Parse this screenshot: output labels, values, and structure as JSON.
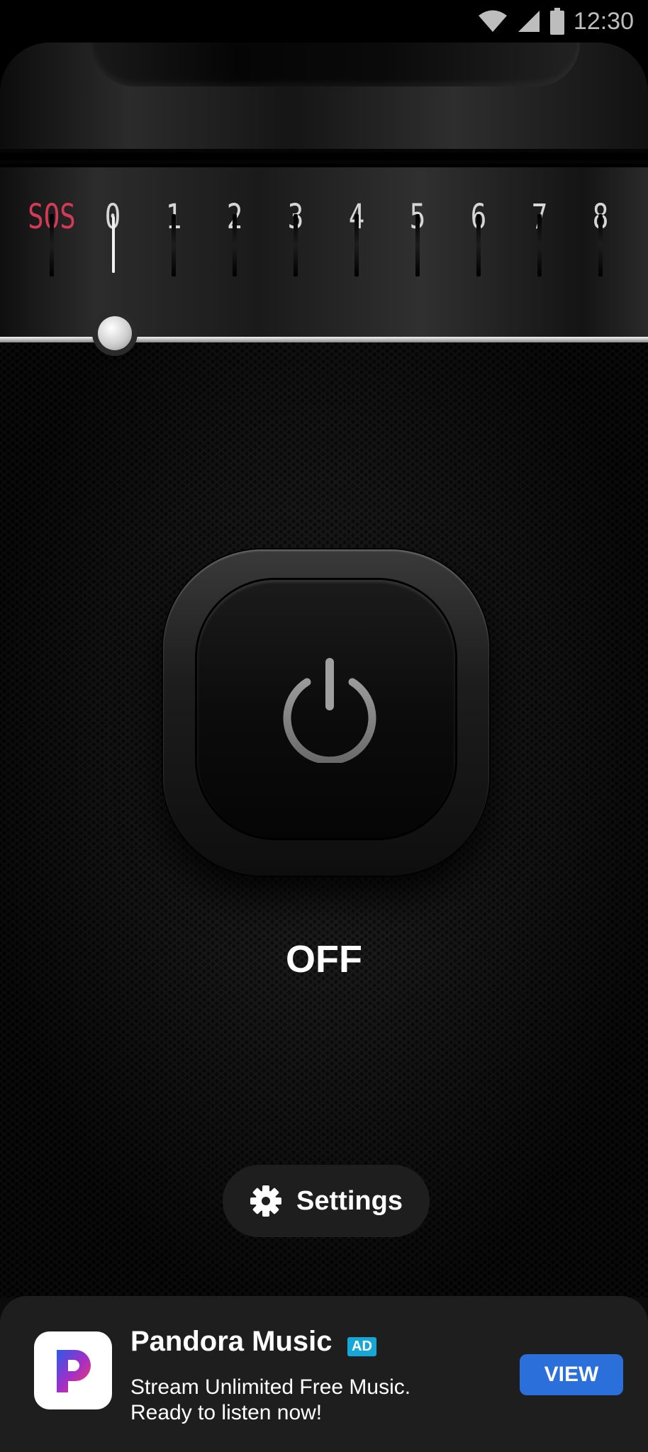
{
  "status_bar": {
    "time": "12:30",
    "icons": [
      "wifi-icon",
      "signal-icon",
      "battery-icon"
    ]
  },
  "dial": {
    "labels": [
      "SOS",
      "0",
      "1",
      "2",
      "3",
      "4",
      "5",
      "6",
      "7",
      "8"
    ],
    "selected": "0",
    "sos_color": "#d23a55"
  },
  "power": {
    "icon": "power-icon",
    "state": "OFF"
  },
  "settings": {
    "icon": "gear-icon",
    "label": "Settings"
  },
  "ad": {
    "app_name": "Pandora Music",
    "badge": "AD",
    "line1": "Stream Unlimited Free Music.",
    "line2": "Ready to listen now!",
    "cta": "VIEW",
    "cta_color": "#2b6fdb"
  }
}
